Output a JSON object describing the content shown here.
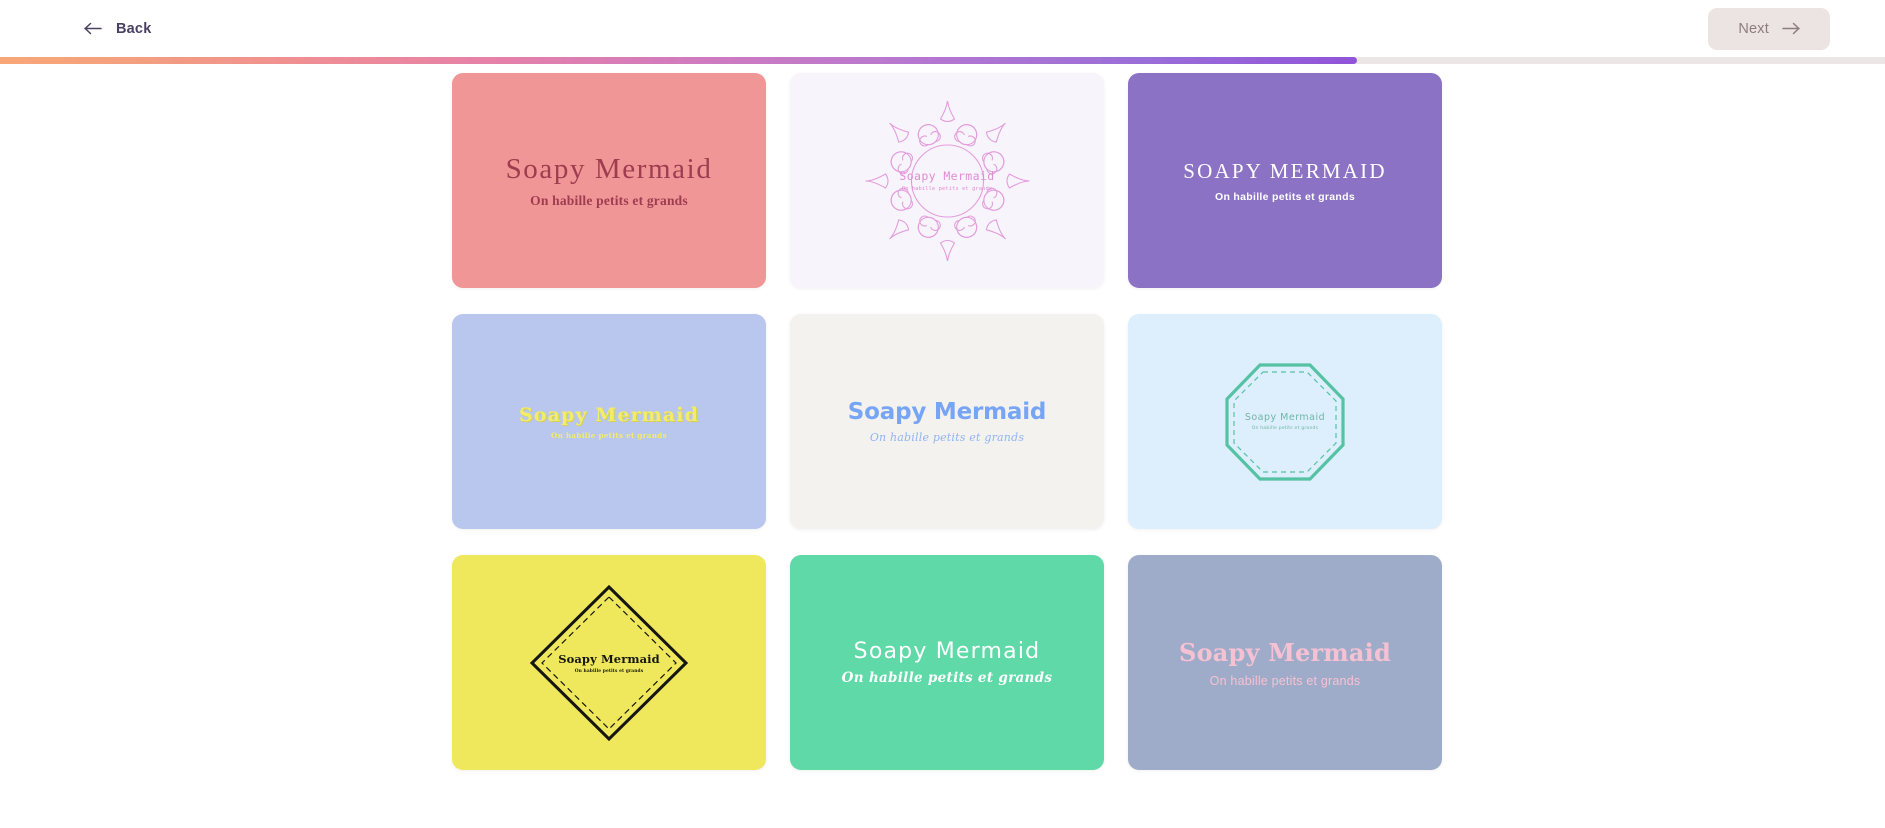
{
  "header": {
    "back_label": "Back",
    "back_icon": "arrow-left-icon",
    "next_label": "Next",
    "next_icon": "arrow-right-icon"
  },
  "progress": {
    "percent": 72,
    "gradient_start": "#f7a777",
    "gradient_mid": "#e681a8",
    "gradient_end": "#9054d8",
    "track_color": "#ece6e6"
  },
  "brand": {
    "name": "Soapy Mermaid",
    "tagline": "On habille petits et grands"
  },
  "logos": [
    {
      "id": "logo-salmon-serif",
      "title": "Soapy Mermaid",
      "tagline": "On habille petits et grands",
      "background": "#f09696",
      "text_color": "#9e3d4f",
      "style": "serif"
    },
    {
      "id": "logo-ornate-frame",
      "title": "Soapy Mermaid",
      "tagline": "On habille petits et grands",
      "background": "#f7f5fb",
      "text_color": "#e08cd6",
      "style": "ornate-scroll-frame"
    },
    {
      "id": "logo-purple-smallcaps",
      "title": "SOAPY MERMAID",
      "tagline": "On habille petits et grands",
      "background": "#8b72c4",
      "text_color": "#ffffff",
      "style": "small-caps-serif"
    },
    {
      "id": "logo-periwinkle-slab",
      "title": "Soapy Mermaid",
      "tagline": "On habille petits et grands",
      "background": "#b9c6ee",
      "text_color": "#f2ed68",
      "style": "bold-slab-serif"
    },
    {
      "id": "logo-cream-cornflower",
      "title": "Soapy Mermaid",
      "tagline": "On habille petits et grands",
      "background": "#f4f2ef",
      "text_color": "#77a5f5",
      "style": "bold-sans-script-sub"
    },
    {
      "id": "logo-teal-octagon",
      "title": "Soapy Mermaid",
      "tagline": "On habille petits et grands",
      "background": "#ddeefc",
      "text_color": "#6fb7a6",
      "style": "octagon-badge"
    },
    {
      "id": "logo-yellow-diamond",
      "title": "Soapy Mermaid",
      "tagline": "On habille petits et grands",
      "background": "#f0e85c",
      "text_color": "#15160f",
      "style": "diamond-badge"
    },
    {
      "id": "logo-mint-decorative",
      "title": "Soapy Mermaid",
      "tagline": "On habille petits et grands",
      "background": "#5fd9a8",
      "text_color": "#ffffff",
      "style": "decorative-sans"
    },
    {
      "id": "logo-slate-pink",
      "title": "Soapy Mermaid",
      "tagline": "On habille petits et grands",
      "background": "#9facc9",
      "text_color": "#f6c1d2",
      "style": "bold-serif"
    }
  ]
}
